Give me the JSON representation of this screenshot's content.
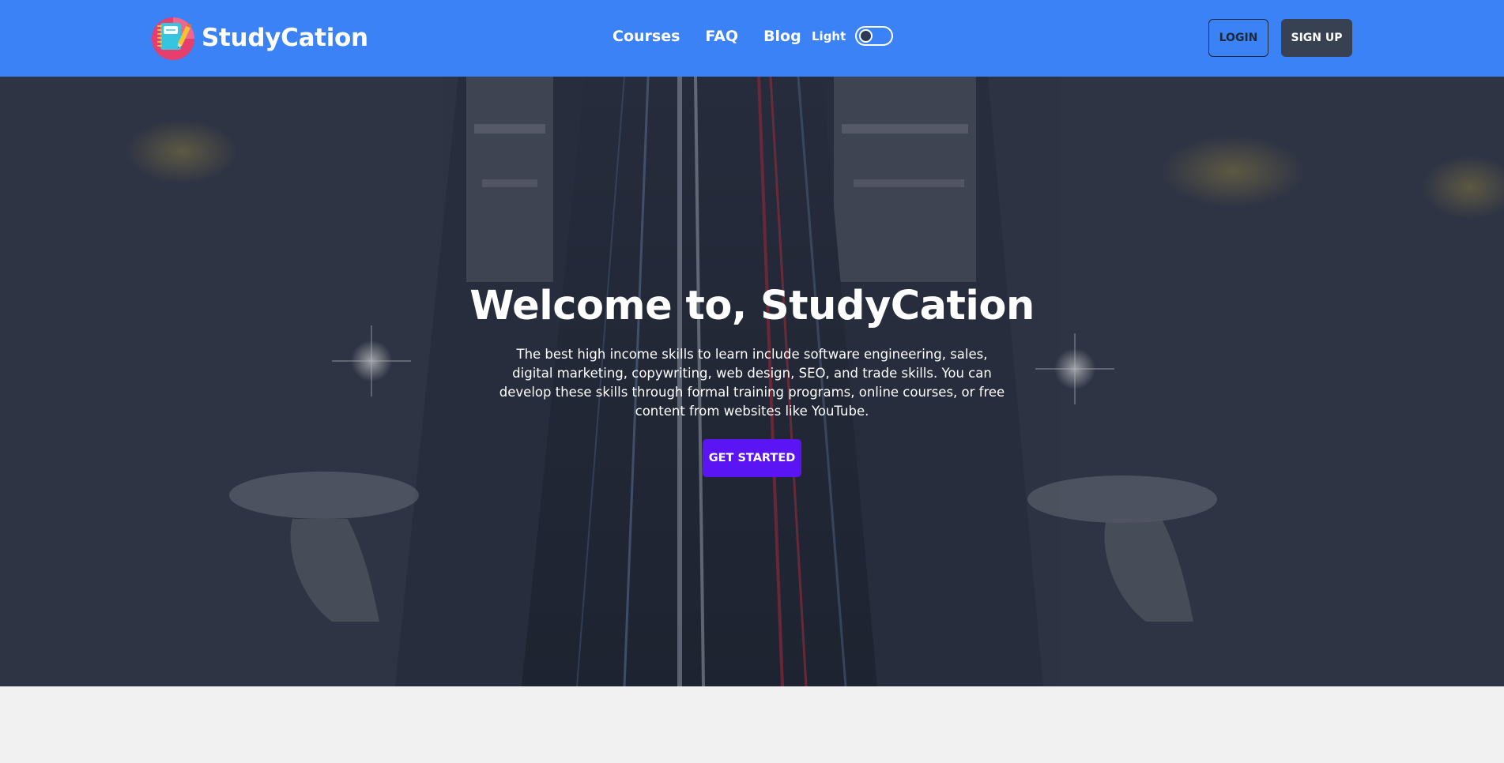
{
  "brand": {
    "name": "StudyCation",
    "logo_icon": "notebook-pencil-icon"
  },
  "nav": {
    "links": [
      {
        "label": "Courses"
      },
      {
        "label": "FAQ"
      },
      {
        "label": "Blog"
      }
    ],
    "theme_label": "Light",
    "theme_toggle_on": false
  },
  "auth": {
    "login_label": "LOGIN",
    "signup_label": "SIGN UP"
  },
  "hero": {
    "title": "Welcome to, StudyCation",
    "description": "The best high income skills to learn include software engineering, sales, digital marketing, copywriting, web design, SEO, and trade skills. You can develop these skills through formal training programs, online courses, or free content from websites like YouTube.",
    "cta_label": "GET STARTED"
  },
  "colors": {
    "navbar": "#3b82f6",
    "cta": "#5b15f5",
    "signup_button": "#374151",
    "page_background": "#f1f1f1"
  }
}
